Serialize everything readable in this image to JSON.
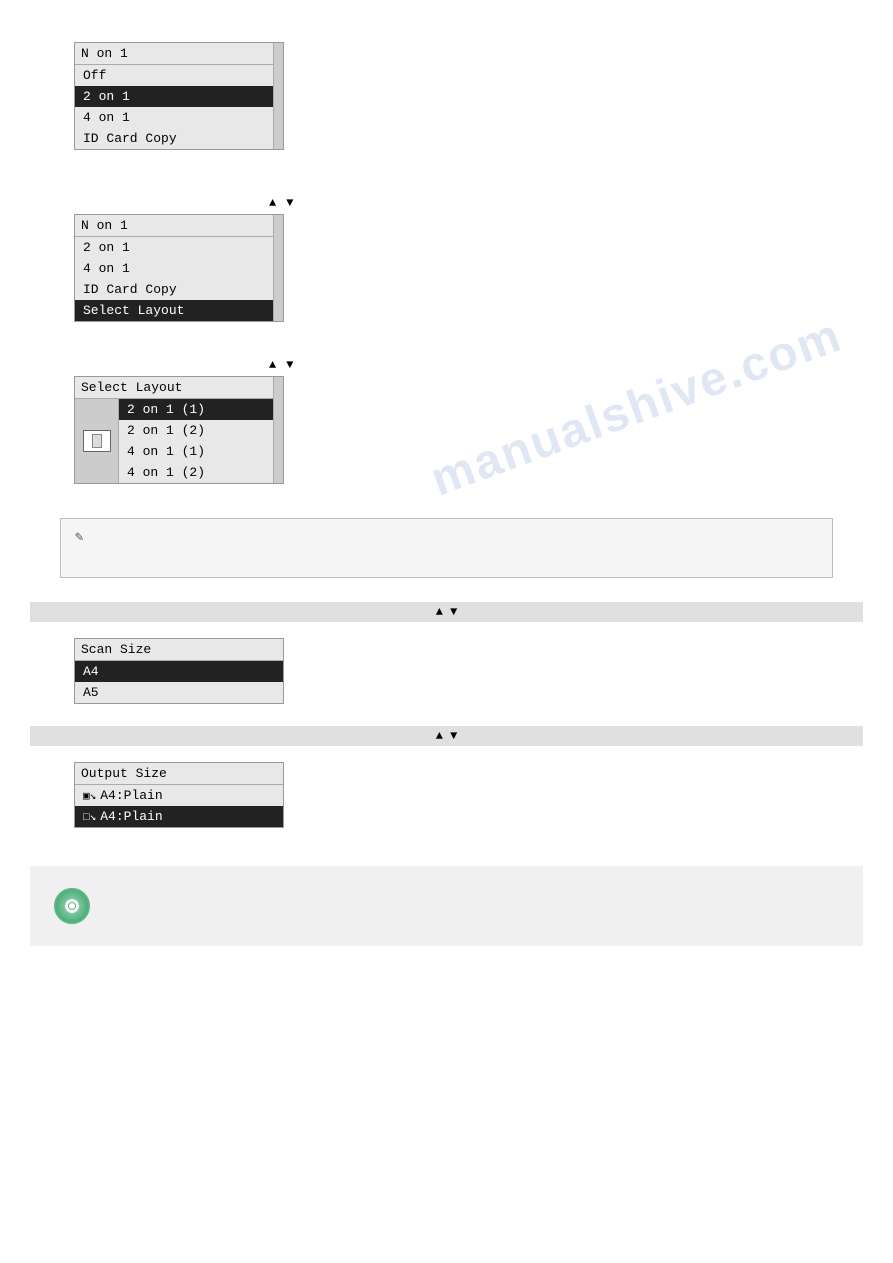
{
  "section1": {
    "title": "N on 1",
    "items": [
      {
        "label": "Off",
        "selected": false
      },
      {
        "label": "2 on 1",
        "selected": true
      },
      {
        "label": "4 on 1",
        "selected": false
      },
      {
        "label": "ID Card Copy",
        "selected": false
      }
    ]
  },
  "section2": {
    "title": "N on 1",
    "items": [
      {
        "label": "2 on 1",
        "selected": false
      },
      {
        "label": "4 on 1",
        "selected": false
      },
      {
        "label": "ID Card Copy",
        "selected": false
      },
      {
        "label": "Select Layout",
        "selected": true
      }
    ]
  },
  "section3": {
    "title": "Select Layout",
    "items": [
      {
        "label": "2 on 1 (1)",
        "selected": true
      },
      {
        "label": "2 on 1 (2)",
        "selected": false
      },
      {
        "label": "4 on 1 (1)",
        "selected": false
      },
      {
        "label": "4 on 1 (2)",
        "selected": false
      }
    ]
  },
  "note": {
    "icon": "✎",
    "text": ""
  },
  "graybar1": {
    "text": "",
    "arrows": "▲  ▼"
  },
  "scanSize": {
    "title": "Scan Size",
    "items": [
      {
        "label": "A4",
        "selected": true
      },
      {
        "label": "A5",
        "selected": false
      }
    ]
  },
  "graybar2": {
    "text": "",
    "arrows": "▲  ▼"
  },
  "outputSize": {
    "title": "Output Size",
    "items": [
      {
        "label": "A4:Plain",
        "selected": false,
        "icon": "tray-multi"
      },
      {
        "label": "A4:Plain",
        "selected": true,
        "icon": "tray-1"
      }
    ]
  },
  "watermark": "manualshive.com",
  "arrows": "▲  ▼"
}
